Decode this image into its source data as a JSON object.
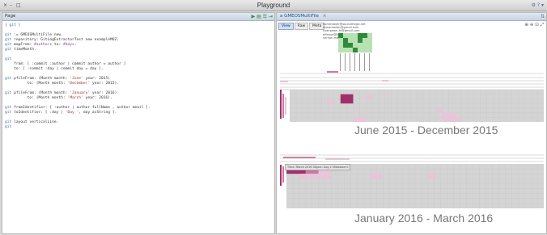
{
  "window": {
    "title": "Playground",
    "controls": [
      "×",
      "–",
      "□"
    ]
  },
  "left_pane": {
    "label": "Page",
    "header_icons": "▶ ▤ ☰ ⇥",
    "code_lines": [
      "| git |",
      "",
      "git := GMEOSMultiFile new.",
      "git repository: GitLogExtractorTest new exampleMOZ.",
      "git mapFrom: #authors to: #days.",
      "git timeMonth.",
      "",
      "git",
      "    from: [ :commit :author | commit author = author ]",
      "    to: [ :commit :day | commit day = day ].",
      "",
      "git pfileFrom: (Month month: 'June' year: 2015)",
      "          to: (Month month: 'December' year: 2015).",
      "",
      "git pfileFrom: (Month month: 'January' year: 2016)",
      "          to: (Month month: 'March' year: 2016).",
      "",
      "git fromIdentifier: [ :author | author fullName , author email ].",
      "git toIdentifier: [ :day | 'Day ', day asString ].",
      "",
      "git layout verticalLine.",
      "git"
    ]
  },
  "right_pane": {
    "tab_label": "a GMEOSMultiFile",
    "tab_close": "×",
    "mode_tabs": [
      "View",
      "Raw",
      "Meta"
    ],
    "zoom_icons": "⊕ ⊖ ⊡ ⤢",
    "author_emails": [
      "dommaster@sourceforge.net",
      "tamamaster@gmail.com",
      "cyanpawn-fn@gmail.com",
      "alfeaud@fanbeat.com",
      "vernon.malterman@gmail.com"
    ],
    "period_1_title": "June 2015 - December 2015",
    "period_2_title": "January 2016 - March 2016",
    "tooltip": "Time: March 2016 Object: Day 1 Milestone 0"
  },
  "colors": {
    "matrix_bg": "#d4d4d4",
    "heat_light": "#e7c6d8",
    "heat_mid": "#c879a5",
    "heat_dark": "#a0306a",
    "green_dark": "#2f8a3c",
    "green_light": "#b9e2b4"
  }
}
